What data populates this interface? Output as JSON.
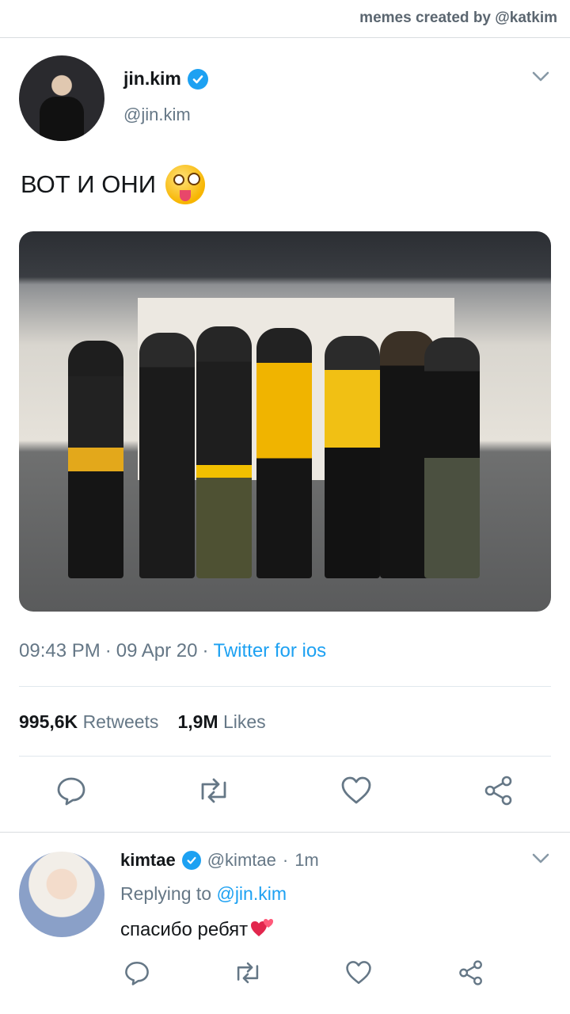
{
  "watermark": "memes created by @katkim",
  "tweet": {
    "display_name": "jin.kim",
    "handle": "@jin.kim",
    "text": "ВОТ И ОНИ",
    "time": "09:43 PM",
    "date": "09 Apr 20",
    "source": "Twitter for ios",
    "retweets_count": "995,6K",
    "retweets_label": "Retweets",
    "likes_count": "1,9M",
    "likes_label": "Likes"
  },
  "reply": {
    "display_name": "kimtae",
    "handle": "@kimtae",
    "time": "1m",
    "replying_label": "Replying to",
    "replying_to": "@jin.kim",
    "text": "спасибо ребят"
  },
  "colors": {
    "accent": "#1da1f2",
    "muted": "#657786",
    "text": "#14171a"
  },
  "icons": [
    "verified-badge-icon",
    "chevron-down-icon",
    "reply-icon",
    "retweet-icon",
    "like-icon",
    "share-icon",
    "tongue-out-emoji",
    "hearts-emoji"
  ]
}
